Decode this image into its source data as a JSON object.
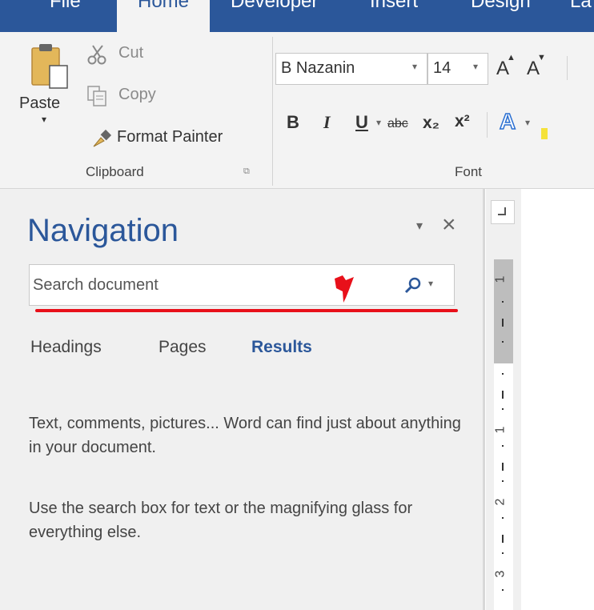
{
  "tabs": {
    "file": "File",
    "home": "Home",
    "developer": "Developer",
    "insert": "Insert",
    "design": "Design",
    "layout_partial": "La"
  },
  "clipboard": {
    "paste": "Paste",
    "cut": "Cut",
    "copy": "Copy",
    "format_painter": "Format Painter",
    "group_label": "Clipboard"
  },
  "font": {
    "font_name": "B Nazanin",
    "font_size": "14",
    "bold": "B",
    "italic": "I",
    "underline": "U",
    "strikethrough": "abc",
    "subscript": "x₂",
    "superscript": "x²",
    "grow": "A",
    "shrink": "A",
    "text_effects": "A",
    "group_label": "Font"
  },
  "navigation": {
    "title": "Navigation",
    "search_placeholder": "Search document",
    "tabs": [
      "Headings",
      "Pages",
      "Results"
    ],
    "active_tab": "Results",
    "message_1": "Text, comments, pictures... Word can find just about anything in your document.",
    "message_2": "Use the search box for text or the magnifying glass for everything else."
  },
  "ruler": {
    "labels": [
      "1",
      "1",
      "2",
      "3"
    ]
  },
  "colors": {
    "ribbon_blue": "#2b579a",
    "ribbon_bg": "#f3f3f3",
    "pane_bg": "#f0f0f0",
    "annotation_red": "#e8101a"
  }
}
